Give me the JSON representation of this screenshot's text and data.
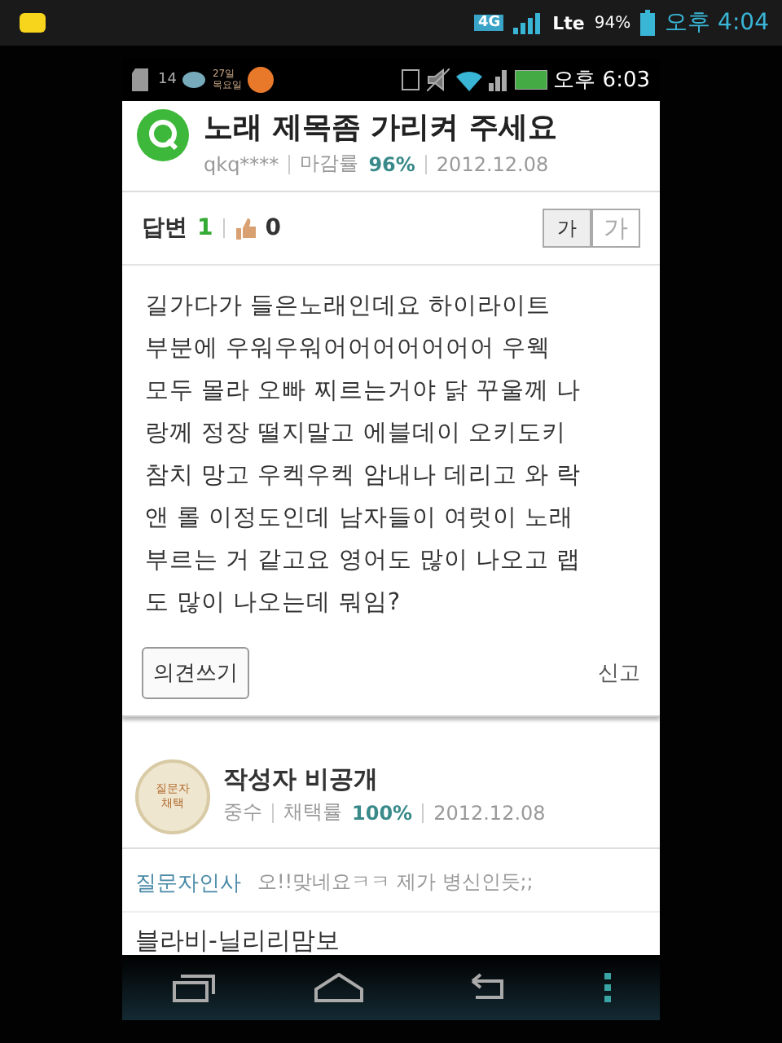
{
  "outer_status_bar": {
    "network": "4G",
    "carrier": "Lte",
    "battery": "94%",
    "time": "오후 4:04"
  },
  "inner_status_bar": {
    "notification_count": "14",
    "calendar": "27일\n목요일",
    "time": "오후 6:03"
  },
  "question": {
    "title": "노래 제목좀 가리켜 주세요",
    "user": "qkq****",
    "rate_label": "마감률",
    "rate": "96%",
    "date": "2012.12.08"
  },
  "answer_bar": {
    "answers_label": "답변",
    "answers": "1",
    "likes": "0",
    "font_buttons": [
      {
        "label": "가",
        "selected": true
      },
      {
        "label": "가",
        "selected": false
      }
    ]
  },
  "body": "길가다가 들은노래인데요 하이라이트\n부분에 우워우워어어어어어어어 우웩\n모두 몰라 오빠 찌르는거야 닭 꾸울께 나\n랑께 정장 떨지말고 에블데이 오키도키\n참치 망고 우켁우켁 암내나 데리고 와 락\n앤 롤 이정도인데 남자들이 여럿이 노래\n부르는 거 같고요 영어도 많이 나오고 랩\n도 많이 나오는데 뭐임?",
  "actions": {
    "comment_button": "의견쓰기",
    "report_link": "신고"
  },
  "answer": {
    "medal": "질문자\n채택",
    "author": "작성자 비공개",
    "level": "중수",
    "rate_label": "채택률",
    "rate": "100%",
    "date": "2012.12.08",
    "thanks_label": "질문자인사",
    "thanks": "오!!맞네요ㅋㅋ 제가 병신인듯;;",
    "text": "블라비-닐리리맘보"
  }
}
